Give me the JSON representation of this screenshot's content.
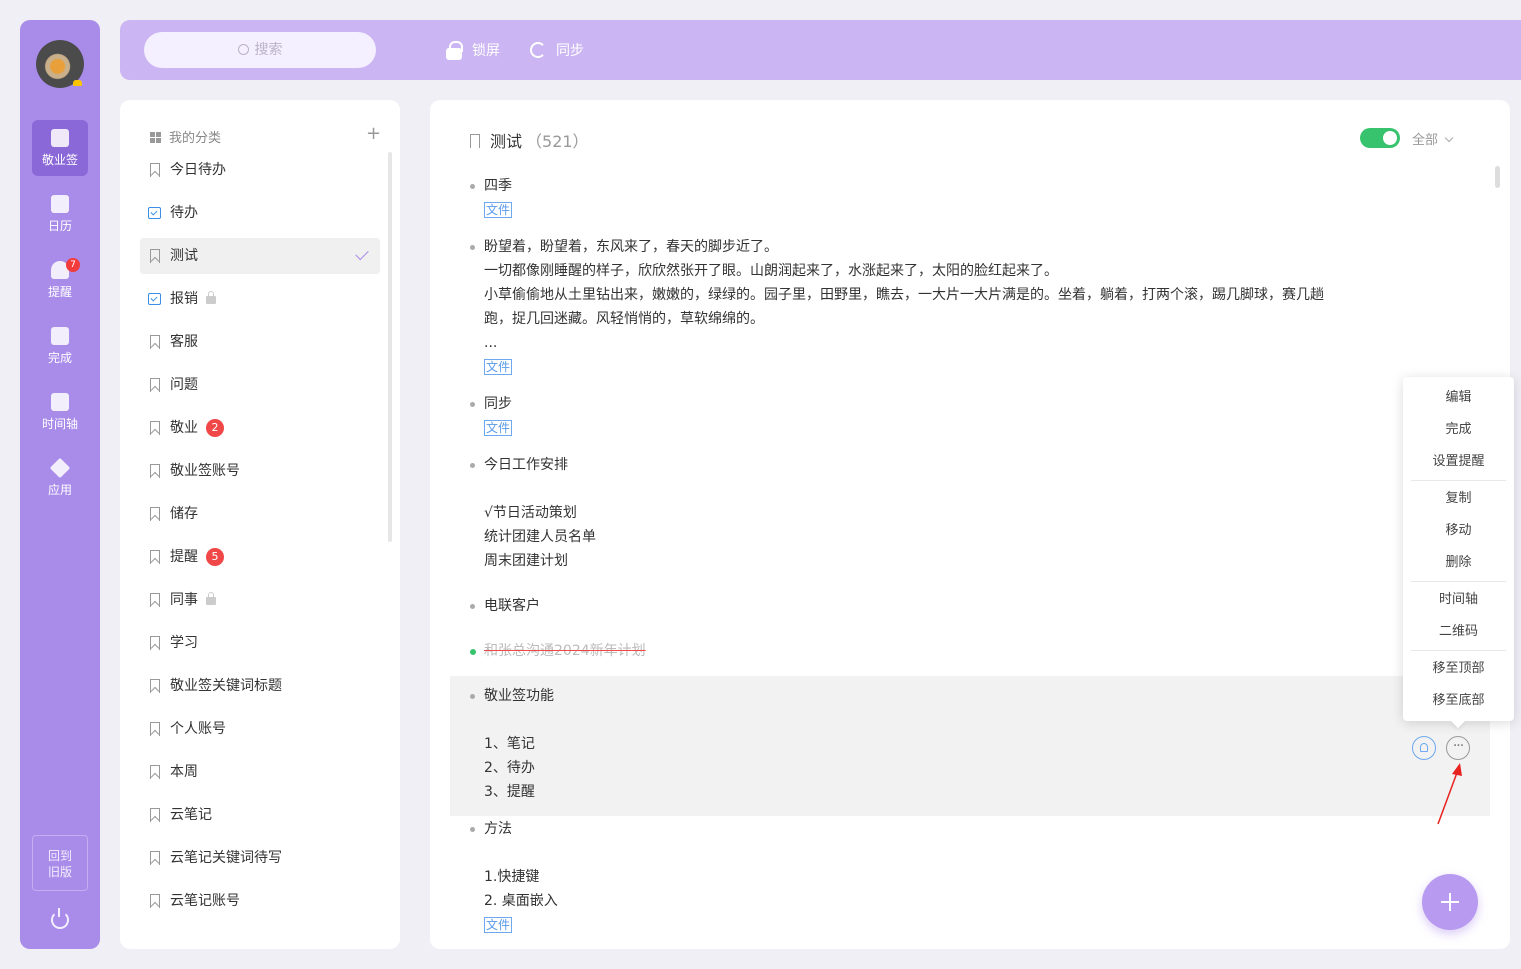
{
  "sidebar": {
    "items": [
      {
        "label": "敬业签",
        "icon": "cloud-note-icon",
        "active": true
      },
      {
        "label": "日历",
        "icon": "calendar-icon"
      },
      {
        "label": "提醒",
        "icon": "bell-icon",
        "badge": "7"
      },
      {
        "label": "完成",
        "icon": "clipboard-check-icon"
      },
      {
        "label": "时间轴",
        "icon": "timeline-icon"
      },
      {
        "label": "应用",
        "icon": "cube-icon"
      }
    ],
    "old_version": "回到\n旧版",
    "old_version_lines": [
      "回到",
      "旧版"
    ]
  },
  "topbar": {
    "search_placeholder": "搜索",
    "lock_label": "锁屏",
    "sync_label": "同步"
  },
  "categories": {
    "header": "我的分类",
    "add": "+",
    "items": [
      {
        "label": "今日待办",
        "icon": "bookmark-icon"
      },
      {
        "label": "待办",
        "icon": "todo-icon"
      },
      {
        "label": "测试",
        "icon": "bookmark-icon",
        "active": true
      },
      {
        "label": "报销",
        "icon": "todo-icon",
        "locked": true
      },
      {
        "label": "客服",
        "icon": "bookmark-icon"
      },
      {
        "label": "问题",
        "icon": "bookmark-icon"
      },
      {
        "label": "敬业",
        "icon": "bookmark-icon",
        "badge": "2"
      },
      {
        "label": "敬业签账号",
        "icon": "bookmark-icon"
      },
      {
        "label": "储存",
        "icon": "bookmark-icon"
      },
      {
        "label": "提醒",
        "icon": "bookmark-icon",
        "badge": "5"
      },
      {
        "label": "同事",
        "icon": "bookmark-icon",
        "locked": true
      },
      {
        "label": "学习",
        "icon": "bookmark-icon"
      },
      {
        "label": "敬业签关键词标题",
        "icon": "bookmark-icon"
      },
      {
        "label": "个人账号",
        "icon": "bookmark-icon"
      },
      {
        "label": "本周",
        "icon": "bookmark-icon"
      },
      {
        "label": "云笔记",
        "icon": "bookmark-icon"
      },
      {
        "label": "云笔记关键词待写",
        "icon": "bookmark-icon"
      },
      {
        "label": "云笔记账号",
        "icon": "bookmark-icon"
      }
    ]
  },
  "main": {
    "title": "测试",
    "count": "（521）",
    "filter": "全部",
    "notes": [
      {
        "lines": [
          "四季"
        ],
        "tag": "文件"
      },
      {
        "lines": [
          "盼望着，盼望着，东风来了，春天的脚步近了。",
          "一切都像刚睡醒的样子，欣欣然张开了眼。山朗润起来了，水涨起来了，太阳的脸红起来了。",
          "小草偷偷地从土里钻出来，嫩嫩的，绿绿的。园子里，田野里，瞧去，一大片一大片满是的。坐着，躺着，打两个滚，踢几脚球，赛几趟",
          "跑，捉几回迷藏。风轻悄悄的，草软绵绵的。",
          "..."
        ],
        "tag": "文件"
      },
      {
        "lines": [
          "同步"
        ],
        "tag": "文件"
      },
      {
        "lines": [
          "今日工作安排",
          "",
          "√节日活动策划",
          "统计团建人员名单",
          "周末团建计划"
        ]
      },
      {
        "lines": [
          "电联客户"
        ]
      },
      {
        "lines": [
          "和张总沟通2024新年计划"
        ],
        "done": true
      },
      {
        "lines": [
          "敬业签功能",
          "",
          "1、笔记",
          "2、待办",
          "3、提醒"
        ],
        "hover": true
      },
      {
        "lines": [
          "方法",
          "",
          "1.快捷键",
          "2. 桌面嵌入"
        ],
        "tag": "文件"
      }
    ]
  },
  "context_menu": {
    "groups": [
      [
        "编辑",
        "完成",
        "设置提醒"
      ],
      [
        "复制",
        "移动",
        "删除"
      ],
      [
        "时间轴",
        "二维码"
      ],
      [
        "移至顶部",
        "移至底部"
      ]
    ]
  },
  "colors": {
    "accent": "#a98be9",
    "topbar": "#cbb5f2",
    "toggle_on": "#37c36e",
    "badge": "#f04848",
    "tag": "#5a9be8"
  }
}
